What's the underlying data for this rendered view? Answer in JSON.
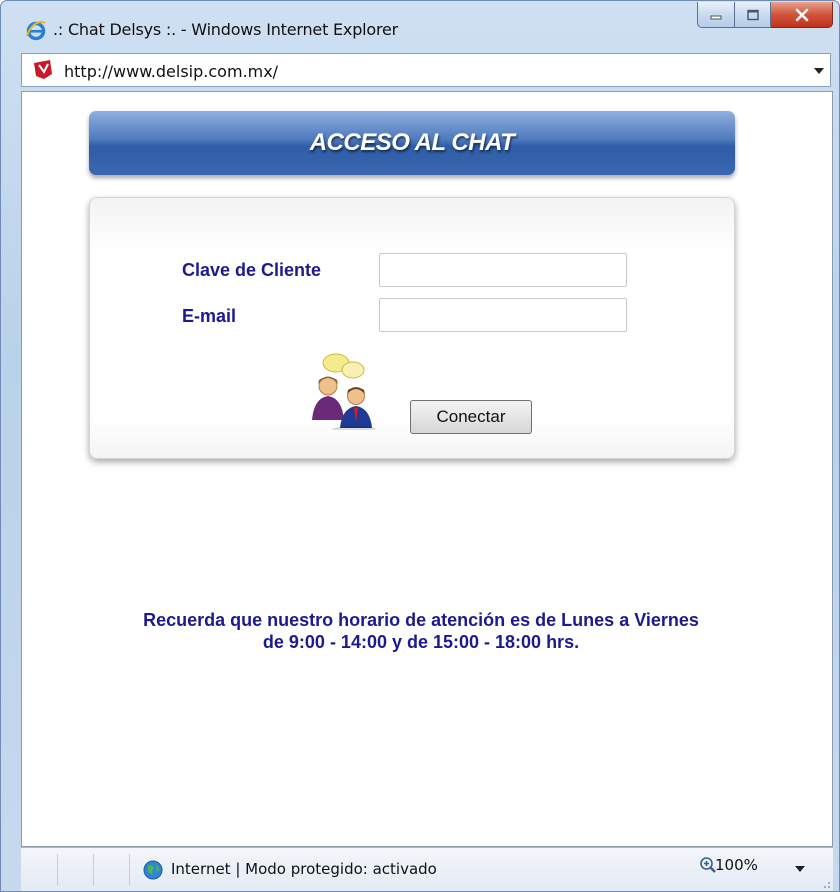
{
  "window": {
    "title": ".: Chat Delsys :. - Windows Internet Explorer"
  },
  "addressbar": {
    "url": "http://www.delsip.com.mx/"
  },
  "page": {
    "header_title": "ACCESO AL CHAT",
    "form": {
      "client_key_label": "Clave de Cliente",
      "client_key_value": "",
      "email_label": "E-mail",
      "email_value": "",
      "connect_button": "Conectar"
    },
    "notice_line1": "Recuerda que nuestro horario de atención es de Lunes a Viernes",
    "notice_line2": "de 9:00 - 14:00 y de 15:00 - 18:00 hrs."
  },
  "statusbar": {
    "zone_text": "Internet | Modo protegido: activado",
    "zoom": "100%"
  },
  "icons": [
    "ie-logo-icon",
    "minimize-icon",
    "maximize-icon",
    "close-icon",
    "site-favicon-icon",
    "dropdown-arrow-icon",
    "chat-people-icon",
    "globe-icon",
    "zoom-icon",
    "resize-grip-icon"
  ],
  "colors": {
    "label_blue": "#1b1b8f",
    "header_blue": "#3a67b0"
  }
}
